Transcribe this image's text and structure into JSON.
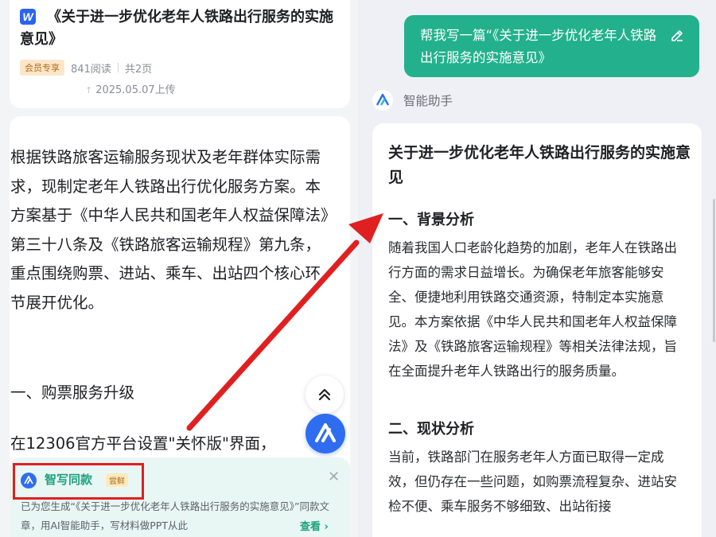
{
  "left": {
    "doc_icon_letter": "W",
    "doc_title": "《关于进一步优化老年人铁路出行服务的实施意见》",
    "vip_badge": "会员专享",
    "reads": "841阅读",
    "pages": "共2页",
    "upload_date": "2025.05.07上传",
    "body_paragraph": "根据铁路旅客运输服务现状及老年群体实际需求，现制定老年人铁路出行优化服务方案。本方案基于《中华人民共和国老年人权益保障法》第三十八条及《铁路旅客运输规程》第九条，重点围绕购票、进站、乘车、出站四个核心环节展开优化。",
    "section_heading": "一、购票服务升级",
    "section_text": "在12306官方平台设置\"关怀版\"界面，",
    "promo": {
      "title": "智写同款",
      "badge": "尝鲜",
      "description": "已为您生成“《关于进一步优化老年人铁路出行服务的实施意见》”同款文章，用AI智能助手，写材料做PPT从此",
      "link": "查看 ›"
    }
  },
  "right": {
    "user_prompt": "帮我写一篇“《关于进一步优化老年人铁路出行服务的实施意见》",
    "assistant_name": "智能助手",
    "answer_title": "关于进一步优化老年人铁路出行服务的实施意见",
    "section1_heading": "一、背景分析",
    "section1_text": "随着我国人口老龄化趋势的加剧，老年人在铁路出行方面的需求日益增长。为确保老年旅客能够安全、便捷地利用铁路交通资源，特制定本实施意见。本方案依据《中华人民共和国老年人权益保障法》及《铁路旅客运输规程》等相关法律法规，旨在全面提升老年人铁路出行的服务质量。",
    "section2_heading": "二、现状分析",
    "section2_text": "当前，铁路部门在服务老年人方面已取得一定成效，但仍存在一些问题，如购票流程复杂、进站安检不便、乘车服务不够细致、出站衔接"
  },
  "colors": {
    "accent_green": "#22b18c",
    "accent_blue": "#2f6df0",
    "annotation_red": "#e02020"
  }
}
